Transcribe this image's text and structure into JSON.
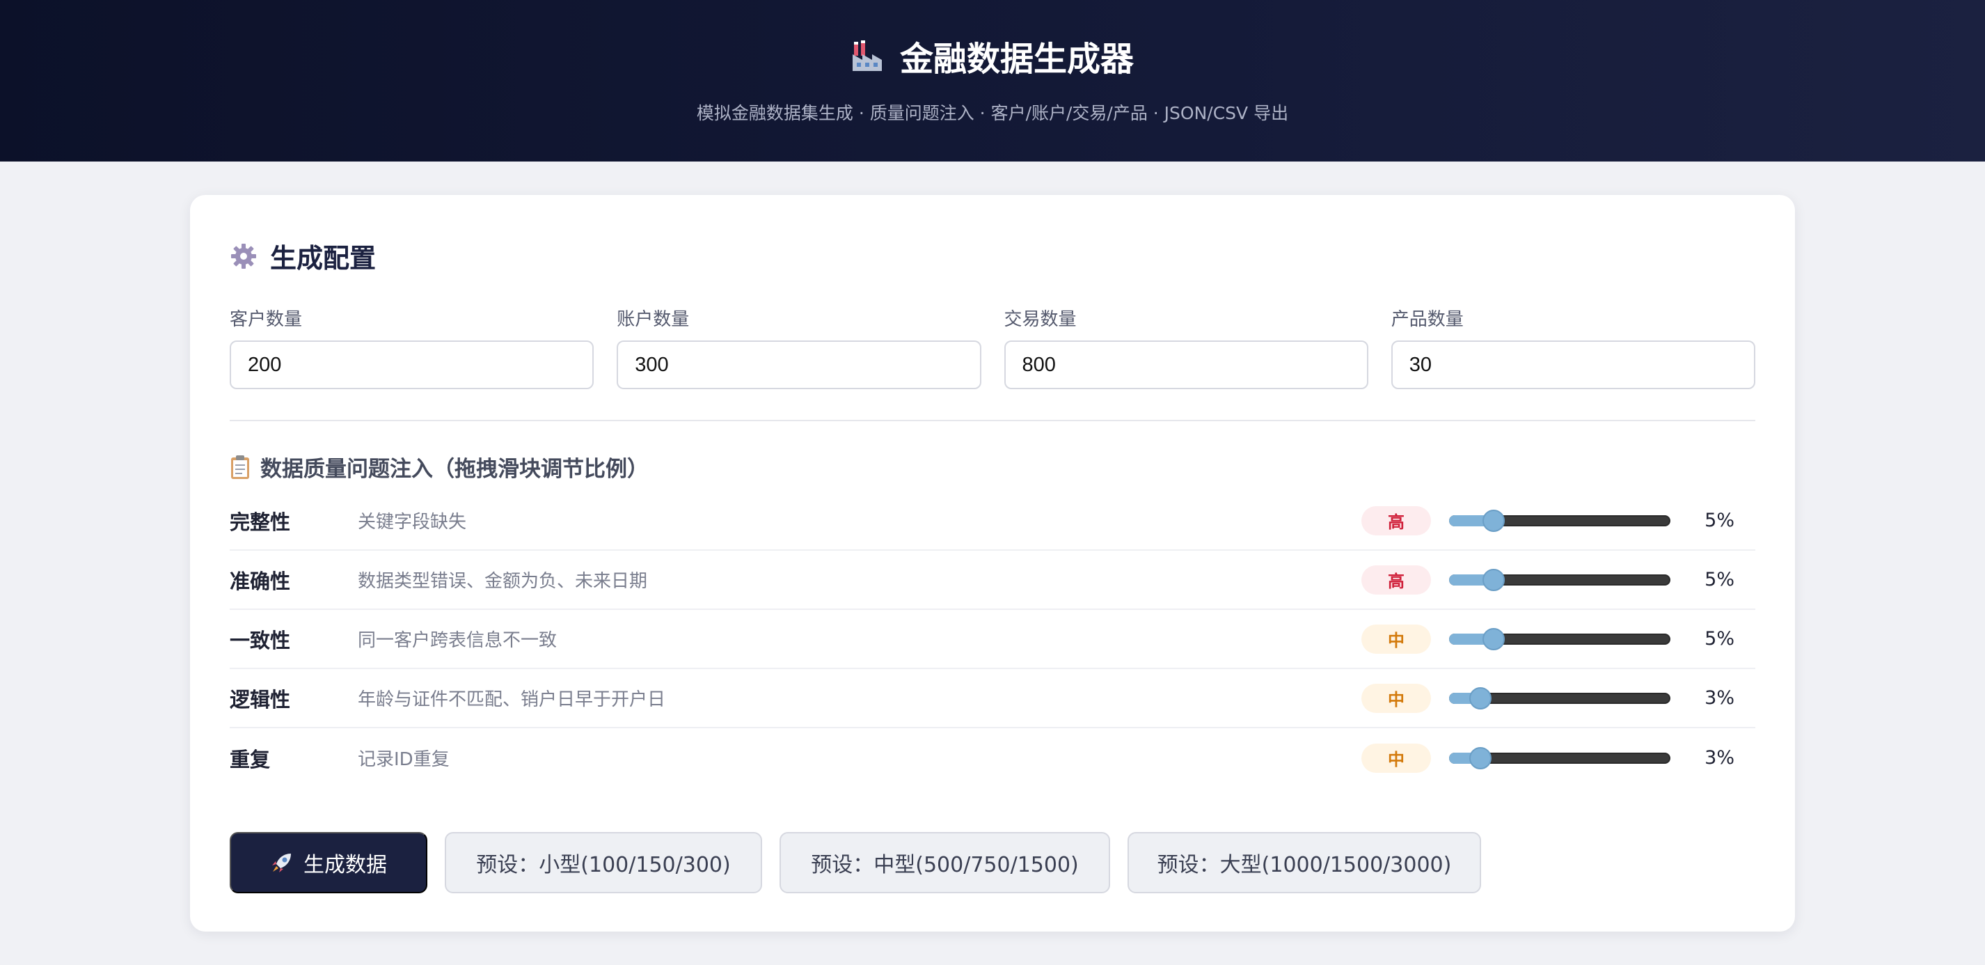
{
  "header": {
    "title": "金融数据生成器",
    "subtitle": "模拟金融数据集生成 · 质量问题注入 · 客户/账户/交易/产品 · JSON/CSV 导出",
    "icon": "factory-icon"
  },
  "config": {
    "title": "生成配置",
    "icon": "gear-icon",
    "fields": [
      {
        "label": "客户数量",
        "value": "200"
      },
      {
        "label": "账户数量",
        "value": "300"
      },
      {
        "label": "交易数量",
        "value": "800"
      },
      {
        "label": "产品数量",
        "value": "30"
      }
    ]
  },
  "quality": {
    "title": "数据质量问题注入（拖拽滑块调节比例）",
    "icon": "clipboard-icon",
    "issues": [
      {
        "name": "完整性",
        "desc": "关键字段缺失",
        "level": "高",
        "level_key": "high",
        "percent": 5,
        "percent_label": "5%"
      },
      {
        "name": "准确性",
        "desc": "数据类型错误、金额为负、未来日期",
        "level": "高",
        "level_key": "high",
        "percent": 5,
        "percent_label": "5%"
      },
      {
        "name": "一致性",
        "desc": "同一客户跨表信息不一致",
        "level": "中",
        "level_key": "mid",
        "percent": 5,
        "percent_label": "5%"
      },
      {
        "name": "逻辑性",
        "desc": "年龄与证件不匹配、销户日早于开户日",
        "level": "中",
        "level_key": "mid",
        "percent": 3,
        "percent_label": "3%"
      },
      {
        "name": "重复",
        "desc": "记录ID重复",
        "level": "中",
        "level_key": "mid",
        "percent": 3,
        "percent_label": "3%"
      }
    ],
    "slider_max": 30
  },
  "actions": {
    "generate_label": "生成数据",
    "generate_icon": "rocket-icon",
    "presets": [
      {
        "label": "预设：小型(100/150/300)"
      },
      {
        "label": "预设：中型(500/750/1500)"
      },
      {
        "label": "预设：大型(1000/1500/3000)"
      }
    ]
  },
  "colors": {
    "header_bg": "#0c1129",
    "primary": "#1b2140",
    "high": "#d0203a",
    "mid": "#d37a0c",
    "slider_accent": "#7fb2d8"
  }
}
